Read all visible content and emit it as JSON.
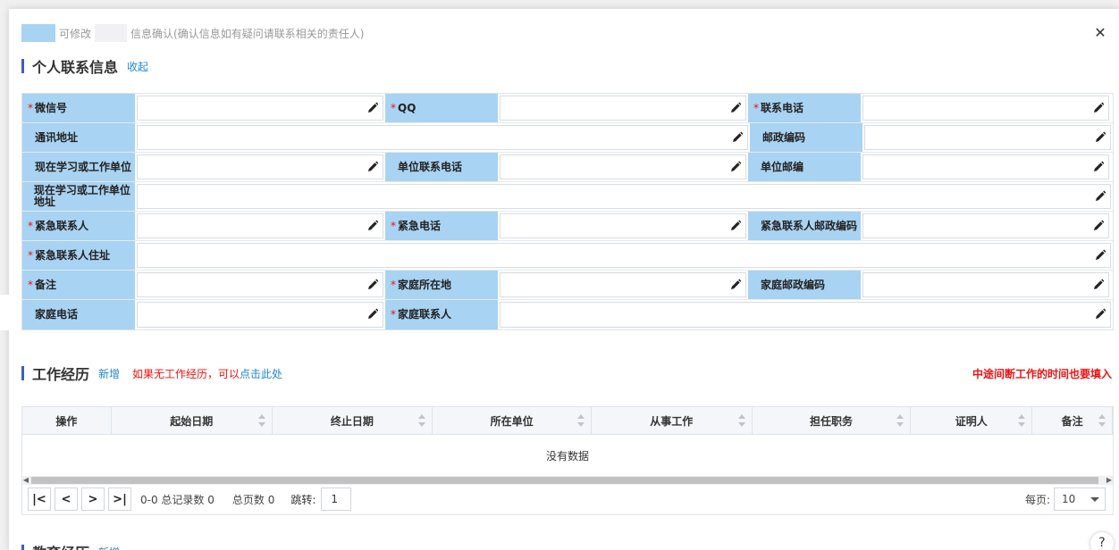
{
  "topbar": {
    "modify": "可修改",
    "confirm": "信息确认(确认信息如有疑问请联系相关的责任人)"
  },
  "contact": {
    "title": "个人联系信息",
    "collapse": "收起",
    "rows": [
      [
        {
          "label": "微信号",
          "req": true
        },
        {
          "label": "QQ",
          "req": true
        },
        {
          "label": "联系电话",
          "req": true
        }
      ],
      [
        {
          "label": "通讯地址",
          "req": false,
          "wide": true
        },
        {
          "label": "邮政编码",
          "req": false
        }
      ],
      [
        {
          "label": "现在学习或工作单位",
          "req": false
        },
        {
          "label": "单位联系电话",
          "req": false
        },
        {
          "label": "单位邮编",
          "req": false
        }
      ],
      [
        {
          "label": "现在学习或工作单位地址",
          "req": false,
          "full": true
        }
      ],
      [
        {
          "label": "紧急联系人",
          "req": true
        },
        {
          "label": "紧急电话",
          "req": true
        },
        {
          "label": "紧急联系人邮政编码",
          "req": false
        }
      ],
      [
        {
          "label": "紧急联系人住址",
          "req": true,
          "full": true
        }
      ],
      [
        {
          "label": "备注",
          "req": true
        },
        {
          "label": "家庭所在地",
          "req": true
        },
        {
          "label": "家庭邮政编码",
          "req": false
        }
      ],
      [
        {
          "label": "家庭电话",
          "req": false
        },
        {
          "label": "家庭联系人",
          "req": true,
          "wide": true
        }
      ]
    ]
  },
  "work": {
    "title": "工作经历",
    "add": "新增",
    "warn_prefix": "如果无工作经历，可以",
    "warn_link": "点击此处",
    "right_warn": "中途间断工作的时间也要填入",
    "columns": [
      "操作",
      "起始日期",
      "终止日期",
      "所在单位",
      "从事工作",
      "担任职务",
      "证明人",
      "备注"
    ],
    "empty": "没有数据",
    "pager": {
      "range": "0-0 总记录数 0",
      "pages": "总页数 0",
      "jump_label": "跳转:",
      "jump_value": "1",
      "per_page_label": "每页:",
      "per_page_value": "10"
    }
  },
  "edu": {
    "title": "教育经历",
    "add": "新增"
  },
  "help": "?"
}
